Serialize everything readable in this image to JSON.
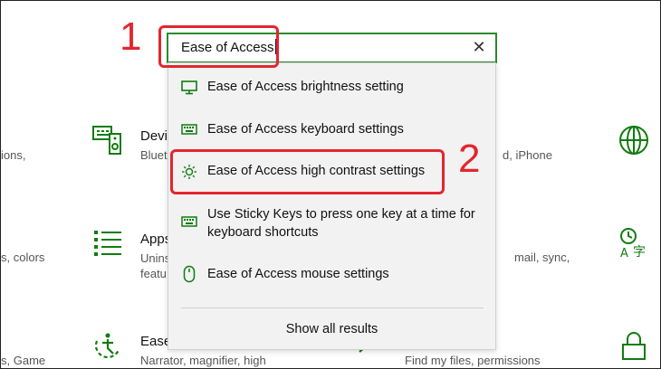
{
  "background": {
    "left_texts": [
      "ions,",
      "s, colors",
      "s, Game"
    ],
    "devices": {
      "title": "Devic",
      "subtitle": "Blueto"
    },
    "apps": {
      "title": "Apps",
      "subtitle1": "Uninst",
      "subtitle2": "featu"
    },
    "ease": {
      "title": "Ease",
      "subtitle": "Narrator, magnifier, high"
    },
    "right_texts": {
      "phone": "d, iPhone",
      "mail": "mail, sync,",
      "search": "Find my files, permissions"
    }
  },
  "search": {
    "value": "Ease of Access",
    "clear_icon": "close-icon"
  },
  "results": [
    {
      "icon": "monitor-icon",
      "label": "Ease of Access brightness setting"
    },
    {
      "icon": "keyboard-icon",
      "label": "Ease of Access keyboard settings"
    },
    {
      "icon": "sun-icon",
      "label": "Ease of Access high contrast settings"
    },
    {
      "icon": "keyboard-icon",
      "label_line1": "Use Sticky Keys to press one key at a time for",
      "label_line2": "keyboard shortcuts"
    },
    {
      "icon": "mouse-icon",
      "label": "Ease of Access mouse settings"
    }
  ],
  "show_all": "Show all results",
  "annotations": {
    "one": "1",
    "two": "2"
  },
  "colors": {
    "accent": "#107c10",
    "annotation": "#e3262f"
  }
}
